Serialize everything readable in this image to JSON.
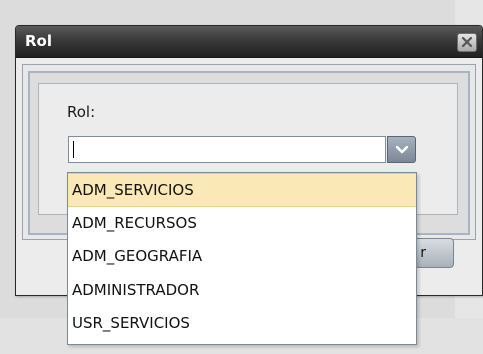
{
  "window": {
    "title": "Rol",
    "close_icon": "close-icon"
  },
  "form": {
    "field_label": "Rol:",
    "field_value": "",
    "dropdown_arrow_icon": "chevron-down-icon"
  },
  "dropdown": {
    "items": [
      {
        "label": "ADM_SERVICIOS",
        "highlighted": true
      },
      {
        "label": "ADM_RECURSOS",
        "highlighted": false
      },
      {
        "label": "ADM_GEOGRAFIA",
        "highlighted": false
      },
      {
        "label": "ADMINISTRADOR",
        "highlighted": false
      },
      {
        "label": "USR_SERVICIOS",
        "highlighted": false
      }
    ]
  },
  "footer": {
    "button_partial_label": "r"
  },
  "colors": {
    "titlebar": "#2e2e2e",
    "highlight": "#fbe8b7",
    "frame_border": "#a9b4c2"
  }
}
